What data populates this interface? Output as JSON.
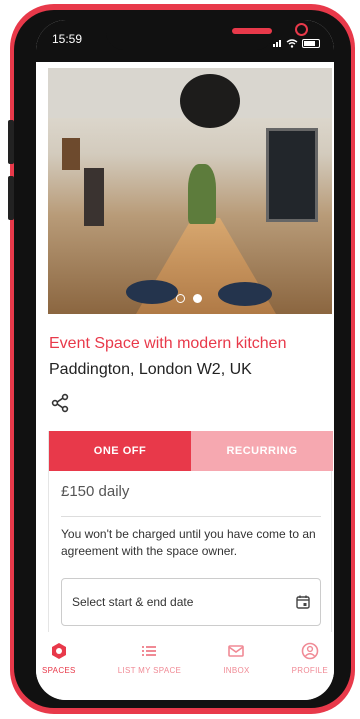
{
  "status_bar": {
    "time": "15:59"
  },
  "listing": {
    "title": "Event Space with modern kitchen",
    "location": "Paddington, London W2, UK"
  },
  "gallery": {
    "slide_count": 2,
    "active_slide": 2
  },
  "booking": {
    "tabs": {
      "one_off": "ONE OFF",
      "recurring": "RECURRING"
    },
    "price": "£150 daily",
    "note": "You won't be charged until you have come to an agreement with the space owner.",
    "date_placeholder": "Select start & end date"
  },
  "bottom_nav": {
    "spaces": "SPACES",
    "list_my_space": "LIST MY SPACE",
    "inbox": "INBOX",
    "profile": "PROFILE"
  },
  "colors": {
    "accent": "#e8394a",
    "accent_light": "#f6a8b0"
  },
  "icons": {
    "share": "share-icon",
    "calendar": "calendar-icon",
    "spaces": "spaces-icon",
    "list": "list-icon",
    "inbox": "inbox-icon",
    "profile": "profile-icon"
  }
}
